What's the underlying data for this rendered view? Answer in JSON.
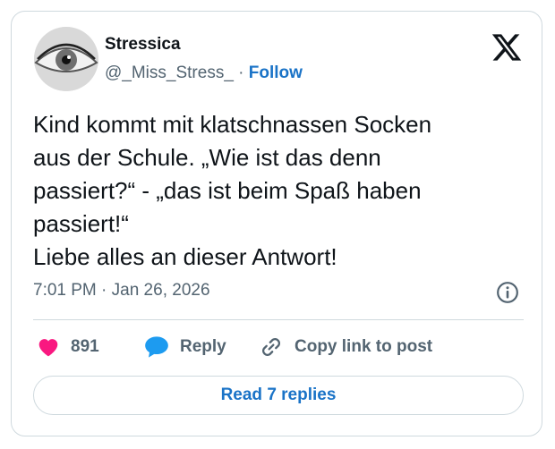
{
  "author": {
    "display_name": "Stressica",
    "handle": "@_Miss_Stress_",
    "separator": "·",
    "follow_label": "Follow"
  },
  "tweet": {
    "lines": [
      "Kind kommt mit klatschnassen Socken",
      "aus der Schule. „Wie ist das denn",
      "passiert?“ - „das ist beim Spaß haben",
      "passiert!“",
      "Liebe alles an dieser Antwort!"
    ],
    "timestamp": "7:01 PM · Jan 26, 2026"
  },
  "actions": {
    "like_count": "891",
    "reply_label": "Reply",
    "copy_label": "Copy link to post"
  },
  "footer": {
    "read_replies_label": "Read 7 replies"
  },
  "icons": {
    "logo": "x-logo-icon",
    "info": "info-icon",
    "like": "heart-icon",
    "reply": "speech-bubble-icon",
    "copy": "link-icon"
  },
  "colors": {
    "accent": "#1a73c7",
    "like": "#f91880",
    "reply": "#1d9bf0",
    "muted": "#536471",
    "border": "#cfd9de"
  }
}
